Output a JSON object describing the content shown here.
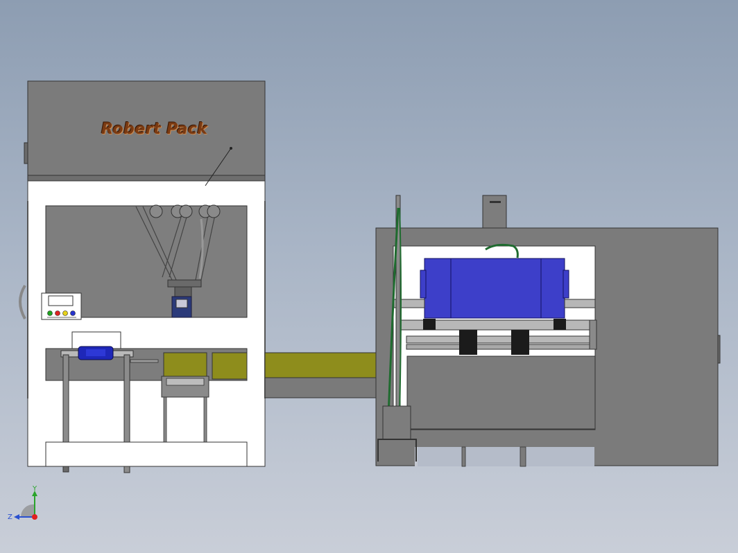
{
  "scene": {
    "brand_label": "Robert Pack",
    "colors": {
      "background_top": "#8d9db2",
      "background_bottom": "#c9ced8",
      "housing_gray": "#7b7b7b",
      "frame_white": "#ffffff",
      "conveyor_olive": "#8e8d1c",
      "carton_blue": "#3d3fc9",
      "cable_green": "#1f6b2f"
    }
  },
  "triad": {
    "y_label": "Y",
    "z_label": "Z",
    "icons": [
      "view-orientation-triad-icon"
    ]
  }
}
